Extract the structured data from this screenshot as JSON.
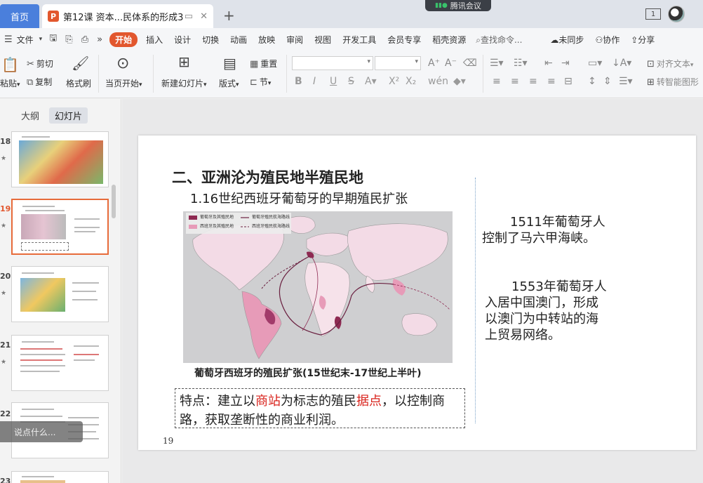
{
  "titlebar": {
    "home_tab": "首页",
    "doc_tab": "第12课 资本...民体系的形成3",
    "doc_badge": "P",
    "add_tab": "+",
    "meeting": "腾讯会议",
    "window_box": "1"
  },
  "menu": {
    "file": "文件",
    "items": [
      "开始",
      "插入",
      "设计",
      "切换",
      "动画",
      "放映",
      "审阅",
      "视图",
      "开发工具",
      "会员专享",
      "稻壳资源"
    ],
    "search": "查找命令...",
    "sync": "未同步",
    "collab": "协作",
    "share": "分享"
  },
  "ribbon": {
    "paste": "粘贴",
    "cut": "剪切",
    "copy": "复制",
    "format_painter": "格式刷",
    "play_from_current": "当页开始",
    "new_slide": "新建幻灯片",
    "layout": "版式",
    "reset": "重置",
    "section": "节",
    "align_text": "对齐文本",
    "smart_graphic": "转智能图形"
  },
  "leftpanel": {
    "tab_outline": "大纲",
    "tab_slides": "幻灯片",
    "say_something": "说点什么...",
    "thumbnails": [
      {
        "num": "18"
      },
      {
        "num": "19"
      },
      {
        "num": "20"
      },
      {
        "num": "21"
      },
      {
        "num": "22"
      },
      {
        "num": "23"
      }
    ]
  },
  "slide": {
    "title": "二、亚洲沦为殖民地半殖民地",
    "subtitle": "1.16世纪西班牙葡萄牙的早期殖民扩张",
    "map_caption": "葡萄牙西班牙的殖民扩张(15世纪末-17世纪上半叶)",
    "map_legend": [
      "葡萄牙及其殖民地",
      "西班牙及其殖民地",
      "葡萄牙殖民航海路线",
      "西班牙殖民航海路线"
    ],
    "note_prefix": "特点：建立以",
    "note_red1": "商站",
    "note_mid": "为标志的殖民",
    "note_red2": "据点",
    "note_suffix": "，以控制商路，获取垄断性的商业利润。",
    "right_text_1a": "1511年葡萄牙人",
    "right_text_1b": "控制了马六甲海峡。",
    "right_text_2a": "1553年葡萄牙人",
    "right_text_2b": "入居中国澳门，形成",
    "right_text_2c": "以澳门为中转站的海",
    "right_text_2d": "上贸易网络。",
    "page_number": "19"
  }
}
